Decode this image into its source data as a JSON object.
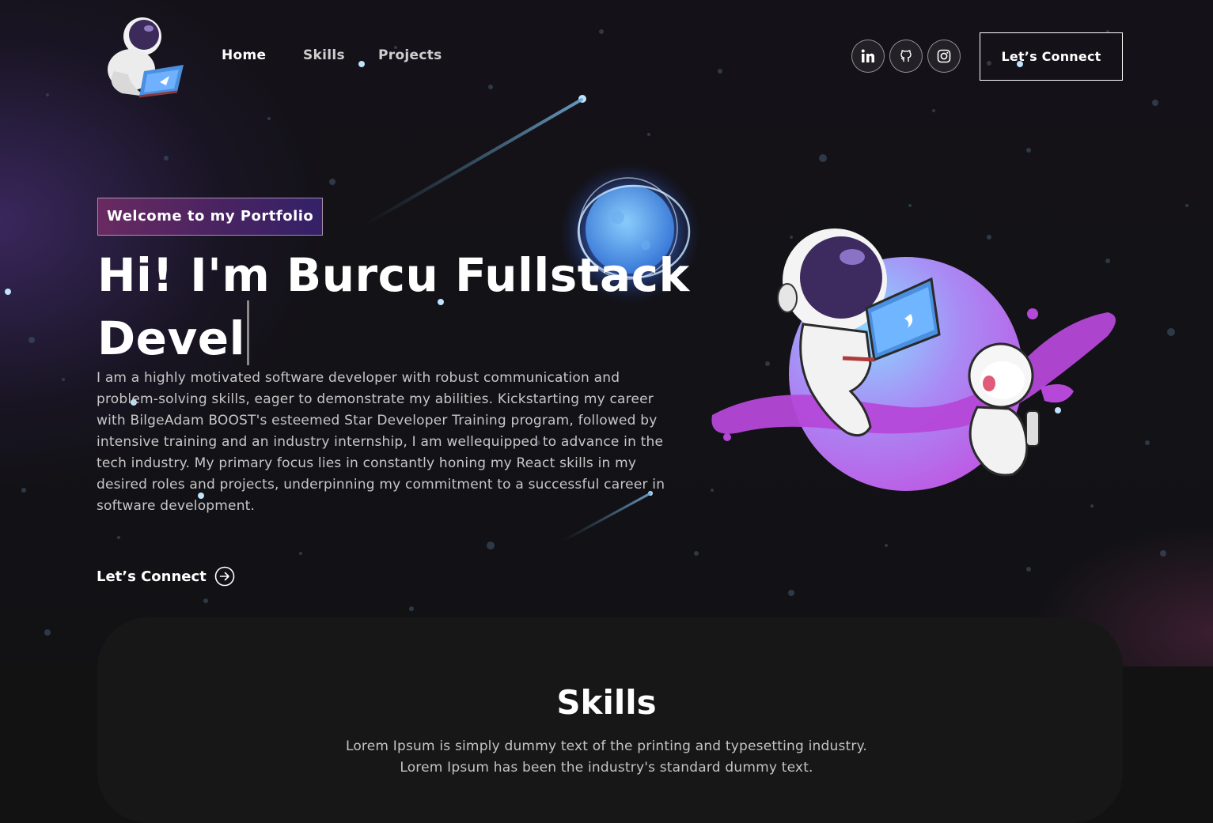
{
  "navbar": {
    "links": [
      {
        "label": "Home"
      },
      {
        "label": "Skills"
      },
      {
        "label": "Projects"
      }
    ],
    "social": [
      "linkedin-icon",
      "github-icon",
      "instagram-icon"
    ],
    "connect_label": "Let’s Connect"
  },
  "banner": {
    "tagline": "Welcome to my Portfolio",
    "headline_line1": "Hi! I'm Burcu Fullstack",
    "headline_line2": "Devel",
    "intro": "I am a highly motivated software developer with robust communication and problem-solving skills, eager to demonstrate my abilities. Kickstarting my career with BilgeAdam BOOST's esteemed Star Developer Training program, followed by intensive training and an industry internship, I am wellequipped to advance in the tech industry. My primary focus lies in constantly honing my React skills in my desired roles and projects, underpinning my commitment to a successful career in software development.",
    "connect_label": "Let’s Connect",
    "connect_icon": "arrow-right-circle-icon"
  },
  "skills": {
    "title": "Skills",
    "text_line1": "Lorem Ipsum is simply dummy text of the printing and typesetting industry.",
    "text_line2": "Lorem Ipsum has been the industry's standard dummy text."
  },
  "colors": {
    "background": "#121212",
    "tagline_gradient_start": "#aa367c",
    "tagline_gradient_end": "#4a2fbd",
    "planet_purple": "#a855f7",
    "planet_blue": "#7cc4ff"
  }
}
